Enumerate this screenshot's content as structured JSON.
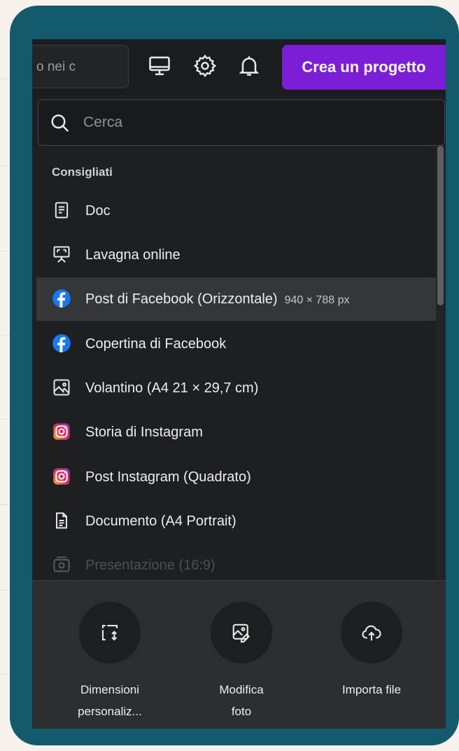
{
  "topbar": {
    "search_partial": "o nei c",
    "create_button": "Crea un progetto",
    "icons": [
      "monitor-icon",
      "gear-icon",
      "bell-icon"
    ]
  },
  "panel": {
    "search_placeholder": "Cerca",
    "section_title": "Consigliati",
    "items": [
      {
        "label": "Doc",
        "icon": "doc-icon"
      },
      {
        "label": "Lavagna online",
        "icon": "whiteboard-icon"
      },
      {
        "label": "Post di Facebook (Orizzontale)",
        "size": "940 × 788 px",
        "icon": "facebook-icon",
        "highlighted": true
      },
      {
        "label": "Copertina di Facebook",
        "icon": "facebook-icon"
      },
      {
        "label": "Volantino (A4 21 × 29,7 cm)",
        "icon": "image-icon"
      },
      {
        "label": "Storia di Instagram",
        "icon": "instagram-icon"
      },
      {
        "label": "Post Instagram (Quadrato)",
        "icon": "instagram-icon"
      },
      {
        "label": "Documento (A4 Portrait)",
        "icon": "document-icon"
      },
      {
        "label": "Presentazione (16:9)",
        "icon": "presentation-icon"
      }
    ]
  },
  "actions": [
    {
      "label_line1": "Dimensioni",
      "label_line2": "personaliz...",
      "icon": "resize-icon"
    },
    {
      "label_line1": "Modifica",
      "label_line2": "foto",
      "icon": "edit-photo-icon"
    },
    {
      "label_line1": "Importa file",
      "label_line2": "",
      "icon": "upload-cloud-icon"
    }
  ],
  "colors": {
    "frame": "#135a6c",
    "accent": "#7a1fd6",
    "facebook": "#1877f2"
  }
}
